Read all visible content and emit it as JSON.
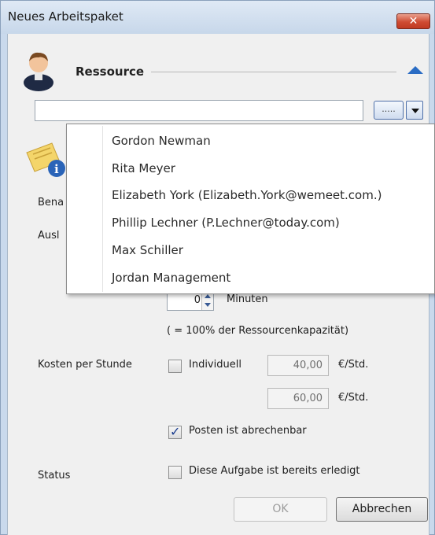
{
  "window": {
    "title": "Neues Arbeitspaket",
    "close_label": "✕"
  },
  "section": {
    "title": "Ressource"
  },
  "resource_input": {
    "value": "",
    "browse_label": "....."
  },
  "dropdown": {
    "items": [
      "Gordon Newman",
      "Rita Meyer",
      "Elizabeth York (Elizabeth.York@wemeet.com.)",
      "Phillip Lechner (P.Lechner@today.com)",
      "Max Schiller",
      "Jordan Management"
    ]
  },
  "labels": {
    "bena": "Bena",
    "ausl": "Ausl",
    "kosten": "Kosten per Stunde",
    "status": "Status"
  },
  "spinner": {
    "value": "0",
    "unit": "Minuten"
  },
  "capacity_note": "( = 100% der Ressourcenkapazität)",
  "cost": {
    "individual_label": "Individuell",
    "individual_checked": false,
    "rate1": "40,00",
    "rate2": "60,00",
    "unit": "€/Std."
  },
  "billable": {
    "label": "Posten ist abrechenbar",
    "checked": true
  },
  "done": {
    "label": "Diese Aufgabe ist bereits erledigt",
    "checked": false
  },
  "buttons": {
    "ok": "OK",
    "cancel": "Abbrechen"
  },
  "colors": {
    "accent": "#2a6cc4",
    "close": "#c03a22"
  }
}
